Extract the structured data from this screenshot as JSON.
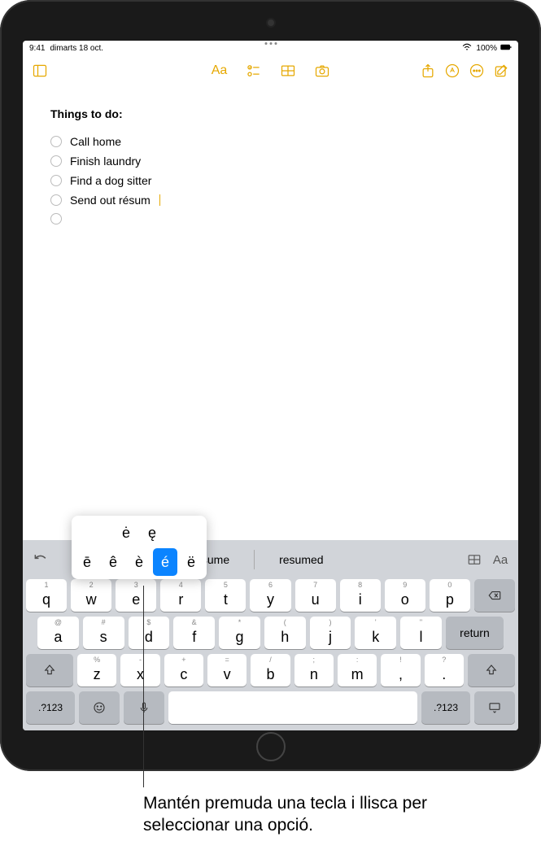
{
  "status": {
    "time": "9:41",
    "date": "dimarts 18 oct.",
    "battery": "100%"
  },
  "toolbar": {
    "sidebar": "sidebar",
    "format": "Aa",
    "checklist": "checklist",
    "table": "table",
    "camera": "camera",
    "share": "share",
    "markup": "markup",
    "more": "more",
    "compose": "compose"
  },
  "note": {
    "title": "Things to do:",
    "items": [
      "Call home",
      "Finish laundry",
      "Find a dog sitter",
      "Send out résum",
      ""
    ]
  },
  "accent_popup": {
    "row_top": [
      "ė",
      "ę"
    ],
    "row_bottom": [
      "ē",
      "ê",
      "è",
      "é",
      "ë"
    ],
    "selected": "é"
  },
  "keyboard": {
    "suggestions": [
      "resume",
      "resumed"
    ],
    "row1": [
      {
        "main": "q",
        "alt": "1"
      },
      {
        "main": "w",
        "alt": "2"
      },
      {
        "main": "e",
        "alt": "3"
      },
      {
        "main": "r",
        "alt": "4"
      },
      {
        "main": "t",
        "alt": "5"
      },
      {
        "main": "y",
        "alt": "6"
      },
      {
        "main": "u",
        "alt": "7"
      },
      {
        "main": "i",
        "alt": "8"
      },
      {
        "main": "o",
        "alt": "9"
      },
      {
        "main": "p",
        "alt": "0"
      }
    ],
    "row2": [
      {
        "main": "a",
        "alt": "@"
      },
      {
        "main": "s",
        "alt": "#"
      },
      {
        "main": "d",
        "alt": "$"
      },
      {
        "main": "f",
        "alt": "&"
      },
      {
        "main": "g",
        "alt": "*"
      },
      {
        "main": "h",
        "alt": "("
      },
      {
        "main": "j",
        "alt": ")"
      },
      {
        "main": "k",
        "alt": "'"
      },
      {
        "main": "l",
        "alt": "\""
      }
    ],
    "row3": [
      {
        "main": "z",
        "alt": "%"
      },
      {
        "main": "x",
        "alt": "-"
      },
      {
        "main": "c",
        "alt": "+"
      },
      {
        "main": "v",
        "alt": "="
      },
      {
        "main": "b",
        "alt": "/"
      },
      {
        "main": "n",
        "alt": ";"
      },
      {
        "main": "m",
        "alt": ":"
      }
    ],
    "row3_extra": [
      {
        "main": "!",
        "alt": ","
      },
      {
        "main": "?",
        "alt": "."
      }
    ],
    "return_label": "return",
    "num_label": ".?123"
  },
  "callout": {
    "text": "Mantén premuda una tecla i llisca per seleccionar una opció."
  }
}
